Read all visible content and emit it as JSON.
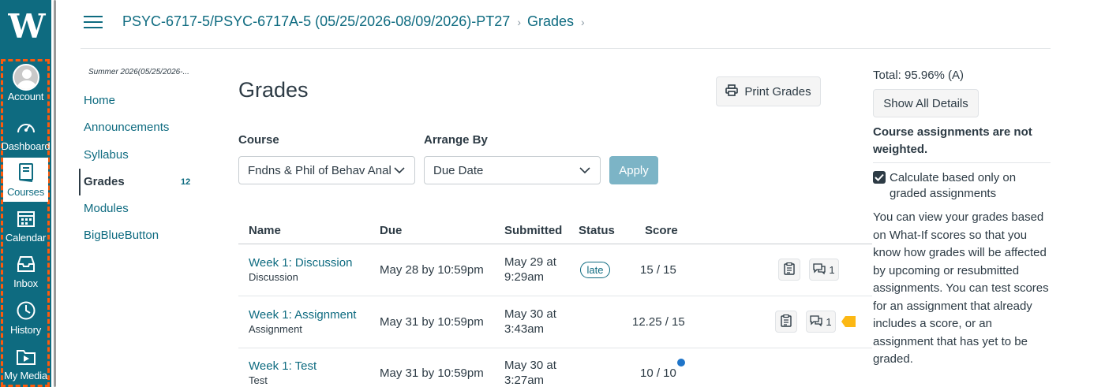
{
  "global_nav": {
    "logo": "W",
    "items": [
      {
        "label": "Account",
        "icon": "user-avatar-icon"
      },
      {
        "label": "Dashboard",
        "icon": "speedometer-icon"
      },
      {
        "label": "Courses",
        "icon": "book-icon"
      },
      {
        "label": "Calendar",
        "icon": "calendar-icon"
      },
      {
        "label": "Inbox",
        "icon": "inbox-icon"
      },
      {
        "label": "History",
        "icon": "clock-icon"
      },
      {
        "label": "My Media",
        "icon": "media-folder-icon"
      }
    ],
    "active": "Courses"
  },
  "breadcrumb": {
    "course": "PSYC-6717-5/PSYC-6717A-5 (05/25/2026-08/09/2026)-PT27",
    "page": "Grades"
  },
  "course_nav": {
    "term": "Summer 2026(05/25/2026-...",
    "items": [
      {
        "label": "Home"
      },
      {
        "label": "Announcements"
      },
      {
        "label": "Syllabus"
      },
      {
        "label": "Grades",
        "badge": "12"
      },
      {
        "label": "Modules"
      },
      {
        "label": "BigBlueButton"
      }
    ],
    "active": "Grades"
  },
  "main": {
    "title": "Grades",
    "print_button": "Print Grades",
    "course_label": "Course",
    "course_value": "Fndns & Phil of Behav Anal",
    "arrange_label": "Arrange By",
    "arrange_value": "Due Date",
    "apply_button": "Apply",
    "columns": [
      "Name",
      "Due",
      "Submitted",
      "Status",
      "Score"
    ],
    "rows": [
      {
        "name": "Week 1: Discussion",
        "type": "Discussion",
        "due": "May 28 by 10:59pm",
        "submitted_1": "May 29 at",
        "submitted_2": "9:29am",
        "status": "late",
        "score": "15 / 15",
        "comments": "1"
      },
      {
        "name": "Week 1: Assignment",
        "type": "Assignment",
        "due": "May 31 by 10:59pm",
        "submitted_1": "May 30 at",
        "submitted_2": "3:43am",
        "status": "",
        "score": "12.25 / 15",
        "comments": "1"
      },
      {
        "name": "Week 1: Test",
        "type": "Test",
        "due": "May 31 by 10:59pm",
        "submitted_1": "May 30 at",
        "submitted_2": "3:27am",
        "status": "",
        "score": "10 / 10",
        "comments": ""
      }
    ]
  },
  "sidebar": {
    "total": "Total: 95.96% (A)",
    "show_all_details": "Show All Details",
    "not_weighted": "Course assignments are not weighted.",
    "calc_checkbox_label": "Calculate based only on graded assignments",
    "calc_checked": true,
    "what_if_text": "You can view your grades based on What-If scores so that you know how grades will be affected by upcoming or resubmitted assignments. You can test scores for an assignment that already includes a score, or an assignment that has yet to be graded."
  },
  "colors": {
    "brand": "#0e6b80",
    "focus_outline": "#ff5a0a",
    "unread": "#1f75c9",
    "flag": "#fcb814"
  }
}
